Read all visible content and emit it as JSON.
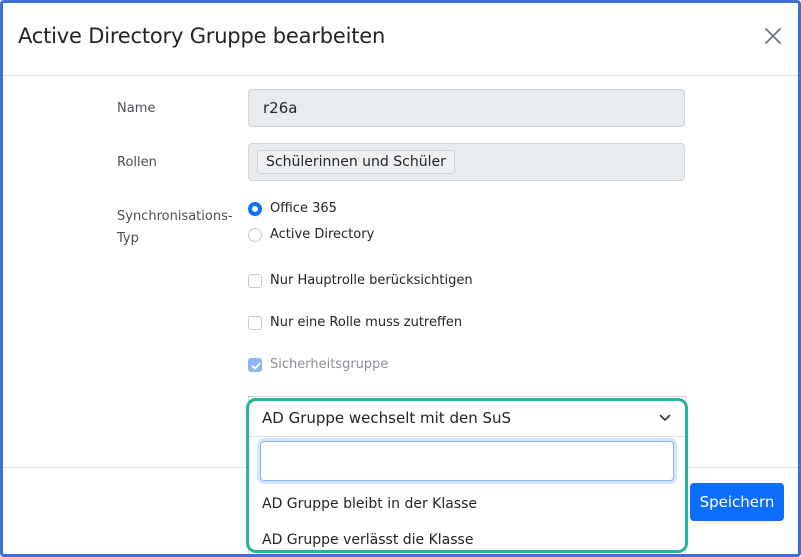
{
  "dialog": {
    "title": "Active Directory Gruppe bearbeiten"
  },
  "form": {
    "name_label": "Name",
    "name_value": "r26a",
    "roles_label": "Rollen",
    "roles_chip": "Schülerinnen und Schüler",
    "sync_label_line1": "Synchronisations-",
    "sync_label_line2": "Typ",
    "sync_options": [
      {
        "label": "Office 365",
        "selected": true
      },
      {
        "label": "Active Directory",
        "selected": false
      }
    ],
    "checkbox_main_role": "Nur Hauptrolle berücksichtigen",
    "checkbox_one_role": "Nur eine Rolle muss zutreffen",
    "checkbox_security": "Sicherheitsgruppe"
  },
  "dropdown": {
    "selected": "AD Gruppe wechselt mit den SuS",
    "search_value": "",
    "options": [
      "AD Gruppe bleibt in der Klasse",
      "AD Gruppe verlässt die Klasse"
    ]
  },
  "footer": {
    "save_label": "Speichern"
  },
  "colors": {
    "primary": "#0d6efd",
    "highlight_border": "#27b39a",
    "frame_border": "#3f6ed8"
  }
}
